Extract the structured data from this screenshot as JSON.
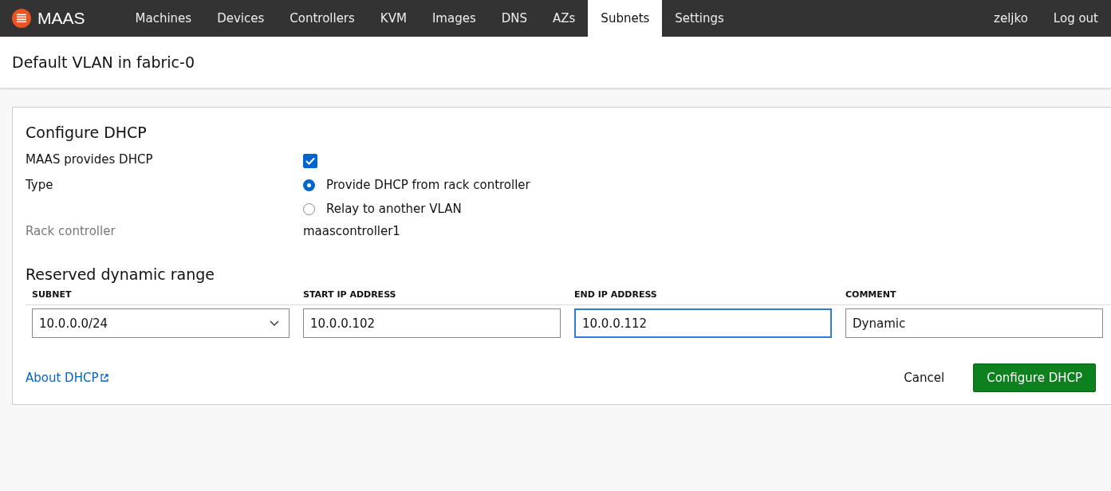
{
  "navbar": {
    "logo": "MAAS",
    "items": [
      {
        "label": "Machines",
        "selected": false
      },
      {
        "label": "Devices",
        "selected": false
      },
      {
        "label": "Controllers",
        "selected": false
      },
      {
        "label": "KVM",
        "selected": false
      },
      {
        "label": "Images",
        "selected": false
      },
      {
        "label": "DNS",
        "selected": false
      },
      {
        "label": "AZs",
        "selected": false
      },
      {
        "label": "Subnets",
        "selected": true
      },
      {
        "label": "Settings",
        "selected": false
      }
    ],
    "user": "zeljko",
    "logout": "Log out"
  },
  "page_title": "Default VLAN in fabric-0",
  "card": {
    "title": "Configure DHCP",
    "provides_label": "MAAS provides DHCP",
    "provides_checked": true,
    "type_label": "Type",
    "type_options": [
      {
        "label": "Provide DHCP from rack controller",
        "selected": true
      },
      {
        "label": "Relay to another VLAN",
        "selected": false
      }
    ],
    "rack_label": "Rack controller",
    "rack_value": "maascontroller1",
    "range_title": "Reserved dynamic range",
    "columns": [
      "SUBNET",
      "START IP ADDRESS",
      "END IP ADDRESS",
      "COMMENT"
    ],
    "row": [
      {
        "kind": "select",
        "value": "10.0.0.0/24",
        "focused": false
      },
      {
        "kind": "input",
        "value": "10.0.0.102",
        "focused": false
      },
      {
        "kind": "input",
        "value": "10.0.0.112",
        "focused": true
      },
      {
        "kind": "input",
        "value": "Dynamic",
        "focused": false
      }
    ],
    "link": "About DHCP",
    "cancel": "Cancel",
    "submit": "Configure DHCP"
  }
}
